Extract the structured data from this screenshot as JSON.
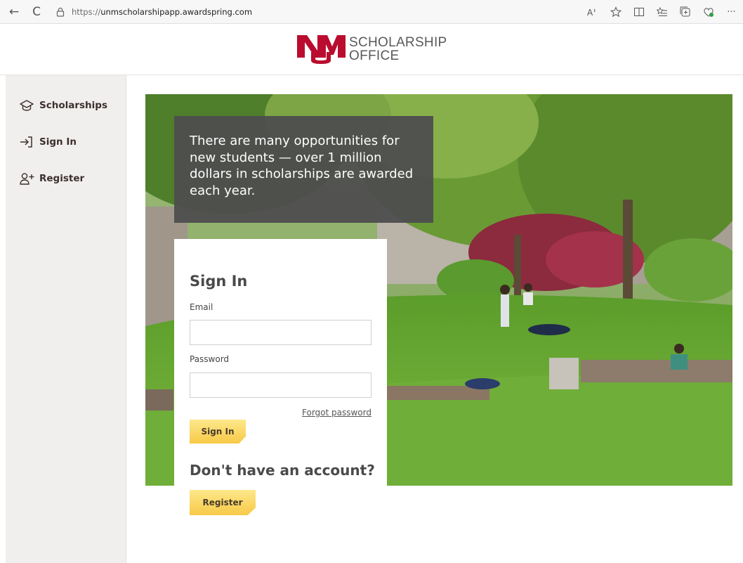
{
  "browser": {
    "url_prefix": "https://",
    "url_host": "unmscholarshipapp.awardspring.com",
    "back_glyph": "←",
    "refresh_glyph": "C",
    "more_glyph": "···"
  },
  "header": {
    "logo_line1": "SCHOLARSHIP",
    "logo_line2": "OFFICE",
    "brand_color": "#ba0c2f"
  },
  "sidebar": {
    "items": [
      {
        "label": "Scholarships",
        "icon": "graduation-cap-icon"
      },
      {
        "label": "Sign In",
        "icon": "sign-in-icon"
      },
      {
        "label": "Register",
        "icon": "add-user-icon"
      }
    ]
  },
  "hero": {
    "banner_text": "There are many opportunities for new students — over 1 million dollars in scholarships are awarded each year."
  },
  "signin": {
    "title": "Sign In",
    "email_label": "Email",
    "email_value": "",
    "password_label": "Password",
    "password_value": "",
    "forgot_label": "Forgot password",
    "button_label": "Sign In",
    "no_account_text": "Don't have an account?",
    "register_label": "Register"
  },
  "colors": {
    "button_gold": "#f7c948",
    "sidebar_bg": "#f1efed",
    "banner_bg": "#4e4e4e"
  }
}
